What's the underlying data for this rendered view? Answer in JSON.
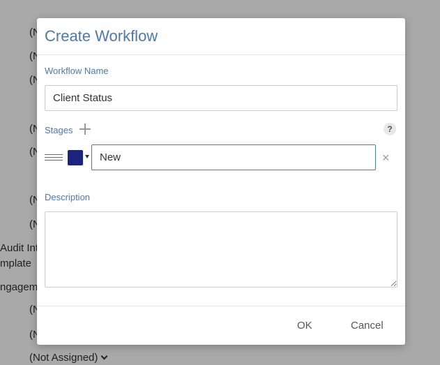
{
  "background": {
    "rows": [
      "(N",
      "(N",
      "(N",
      "(N",
      "(N",
      "(N",
      "(N",
      "Audit Int",
      "mplate",
      "ngageme",
      "(N",
      "(N"
    ],
    "assignee_select_value": "(Not Assigned)"
  },
  "dialog": {
    "title": "Create Workflow",
    "workflow_name_label": "Workflow Name",
    "workflow_name_value": "Client Status",
    "stages_label": "Stages",
    "help_glyph": "?",
    "stage": {
      "color": "#1a237e",
      "name_value": "New",
      "remove_glyph": "×"
    },
    "description_label": "Description",
    "description_value": "",
    "ok_label": "OK",
    "cancel_label": "Cancel"
  }
}
